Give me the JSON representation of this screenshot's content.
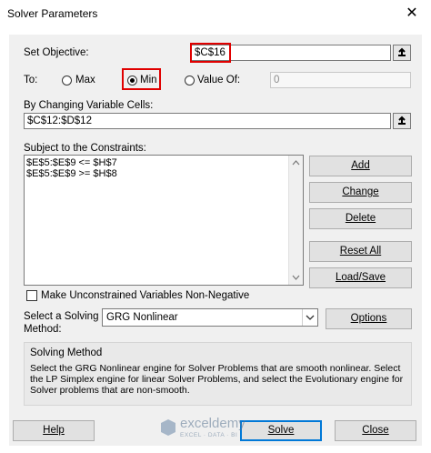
{
  "window": {
    "title": "Solver Parameters"
  },
  "objective": {
    "label": "Set Objective:",
    "value": "$C$16"
  },
  "to": {
    "label": "To:",
    "max_label": "Max",
    "min_label": "Min",
    "value_of_label": "Value Of:",
    "value_of": "0",
    "selected": "Min"
  },
  "changing": {
    "label": "By Changing Variable Cells:",
    "value": "$C$12:$D$12"
  },
  "constraints": {
    "label": "Subject to the Constraints:",
    "items": [
      "$E$5:$E$9 <= $H$7",
      "$E$5:$E$9 >= $H$8"
    ]
  },
  "buttons": {
    "add": "Add",
    "change": "Change",
    "delete": "Delete",
    "reset_all": "Reset All",
    "load_save": "Load/Save",
    "options": "Options",
    "help": "Help",
    "solve": "Solve",
    "close": "Close"
  },
  "nonneg": {
    "label": "Make Unconstrained Variables Non-Negative",
    "checked": false
  },
  "method": {
    "label_line1": "Select a Solving",
    "label_line2": "Method:",
    "selected": "GRG Nonlinear"
  },
  "solving_method": {
    "title": "Solving Method",
    "text": "Select the GRG Nonlinear engine for Solver Problems that are smooth nonlinear. Select the LP Simplex engine for linear Solver Problems, and select the Evolutionary engine for Solver problems that are non-smooth."
  },
  "watermark": {
    "brand": "exceldemy",
    "tagline": "EXCEL · DATA · BI"
  },
  "colors": {
    "highlight": "#e00000",
    "solve_border": "#0078d7"
  }
}
